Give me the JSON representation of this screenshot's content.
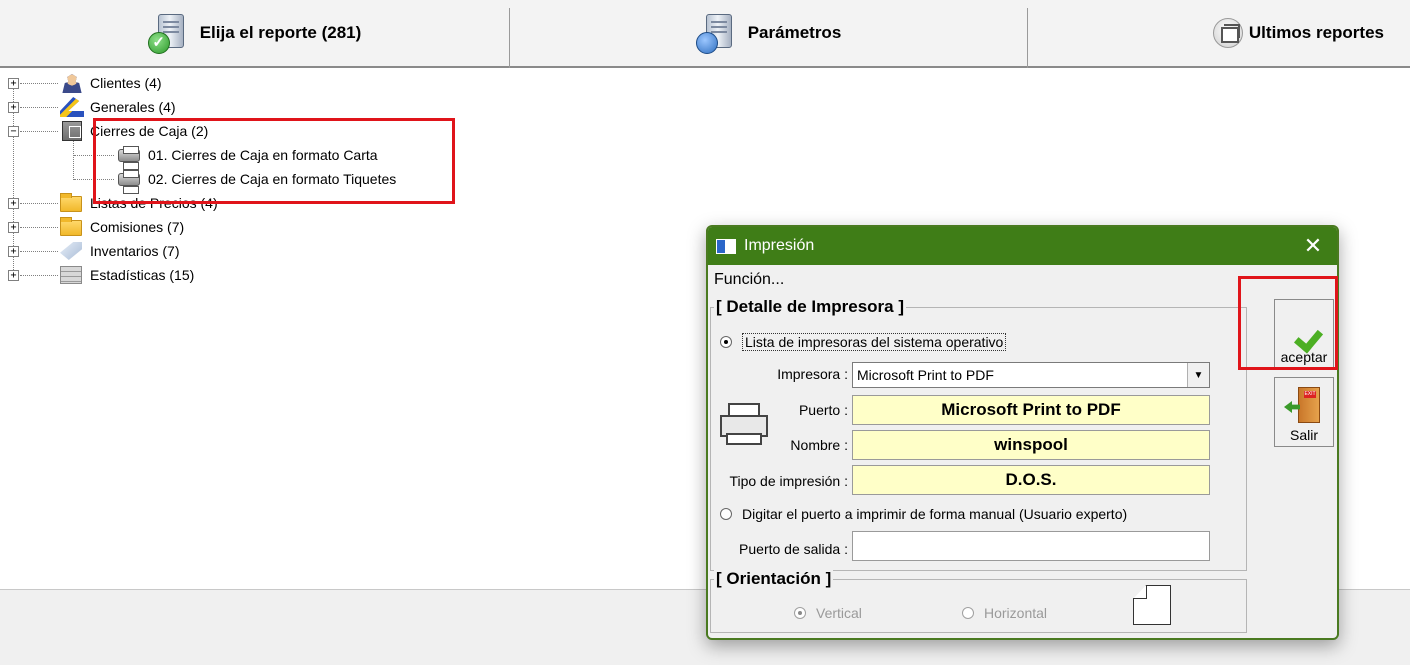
{
  "tabs": [
    {
      "label": "Elija el reporte (281)",
      "icon": "server-check-icon"
    },
    {
      "label": "Parámetros",
      "icon": "server-database-icon"
    },
    {
      "label": "Ultimos reportes",
      "icon": "recent-windows-icon"
    }
  ],
  "tree": {
    "nodes": [
      {
        "label": "Clientes (4)",
        "icon": "clients-icon",
        "expanded": false
      },
      {
        "label": "Generales (4)",
        "icon": "pencil-icon",
        "expanded": false
      },
      {
        "label": "Cierres de Caja (2)",
        "icon": "cash-register-icon",
        "expanded": true,
        "children": [
          {
            "label": "01. Cierres de Caja en formato Carta",
            "icon": "printer-icon"
          },
          {
            "label": "02. Cierres de Caja en formato Tiquetes",
            "icon": "printer-icon"
          }
        ]
      },
      {
        "label": "Listas de Precios (4)",
        "icon": "folder-icon",
        "expanded": false
      },
      {
        "label": "Comisiones (7)",
        "icon": "folder-icon",
        "expanded": false
      },
      {
        "label": "Inventarios (7)",
        "icon": "tag-icon",
        "expanded": false
      },
      {
        "label": "Estadísticas (15)",
        "icon": "stats-icon",
        "expanded": false
      }
    ]
  },
  "dialog": {
    "title": "Impresión",
    "close": "✕",
    "menu": "Función...",
    "printer_group": {
      "title": "[ Detalle de Impresora ]",
      "radio_system": "Lista de impresoras del sistema operativo",
      "radio_system_selected": true,
      "printer_label": "Impresora :",
      "printer_value": "Microsoft Print to PDF",
      "port_label": "Puerto :",
      "port_value": "Microsoft Print to PDF",
      "name_label": "Nombre :",
      "name_value": "winspool",
      "type_label": "Tipo de impresión :",
      "type_value": "D.O.S.",
      "radio_manual": "Digitar el puerto a imprimir de forma manual (Usuario experto)",
      "radio_manual_selected": false,
      "output_port_label": "Puerto de salida :",
      "output_port_value": ""
    },
    "orientation_group": {
      "title": "[ Orientación ]",
      "vertical": "Vertical",
      "horizontal": "Horizontal",
      "selected": "Vertical"
    },
    "buttons": {
      "accept": "aceptar",
      "exit": "Salir",
      "exit_sign": "EXIT"
    }
  },
  "colors": {
    "dialog_title_bg": "#3f7d17",
    "highlight": "#e0141a",
    "field_yellow": "#ffffc8",
    "check_green": "#4caf23"
  }
}
